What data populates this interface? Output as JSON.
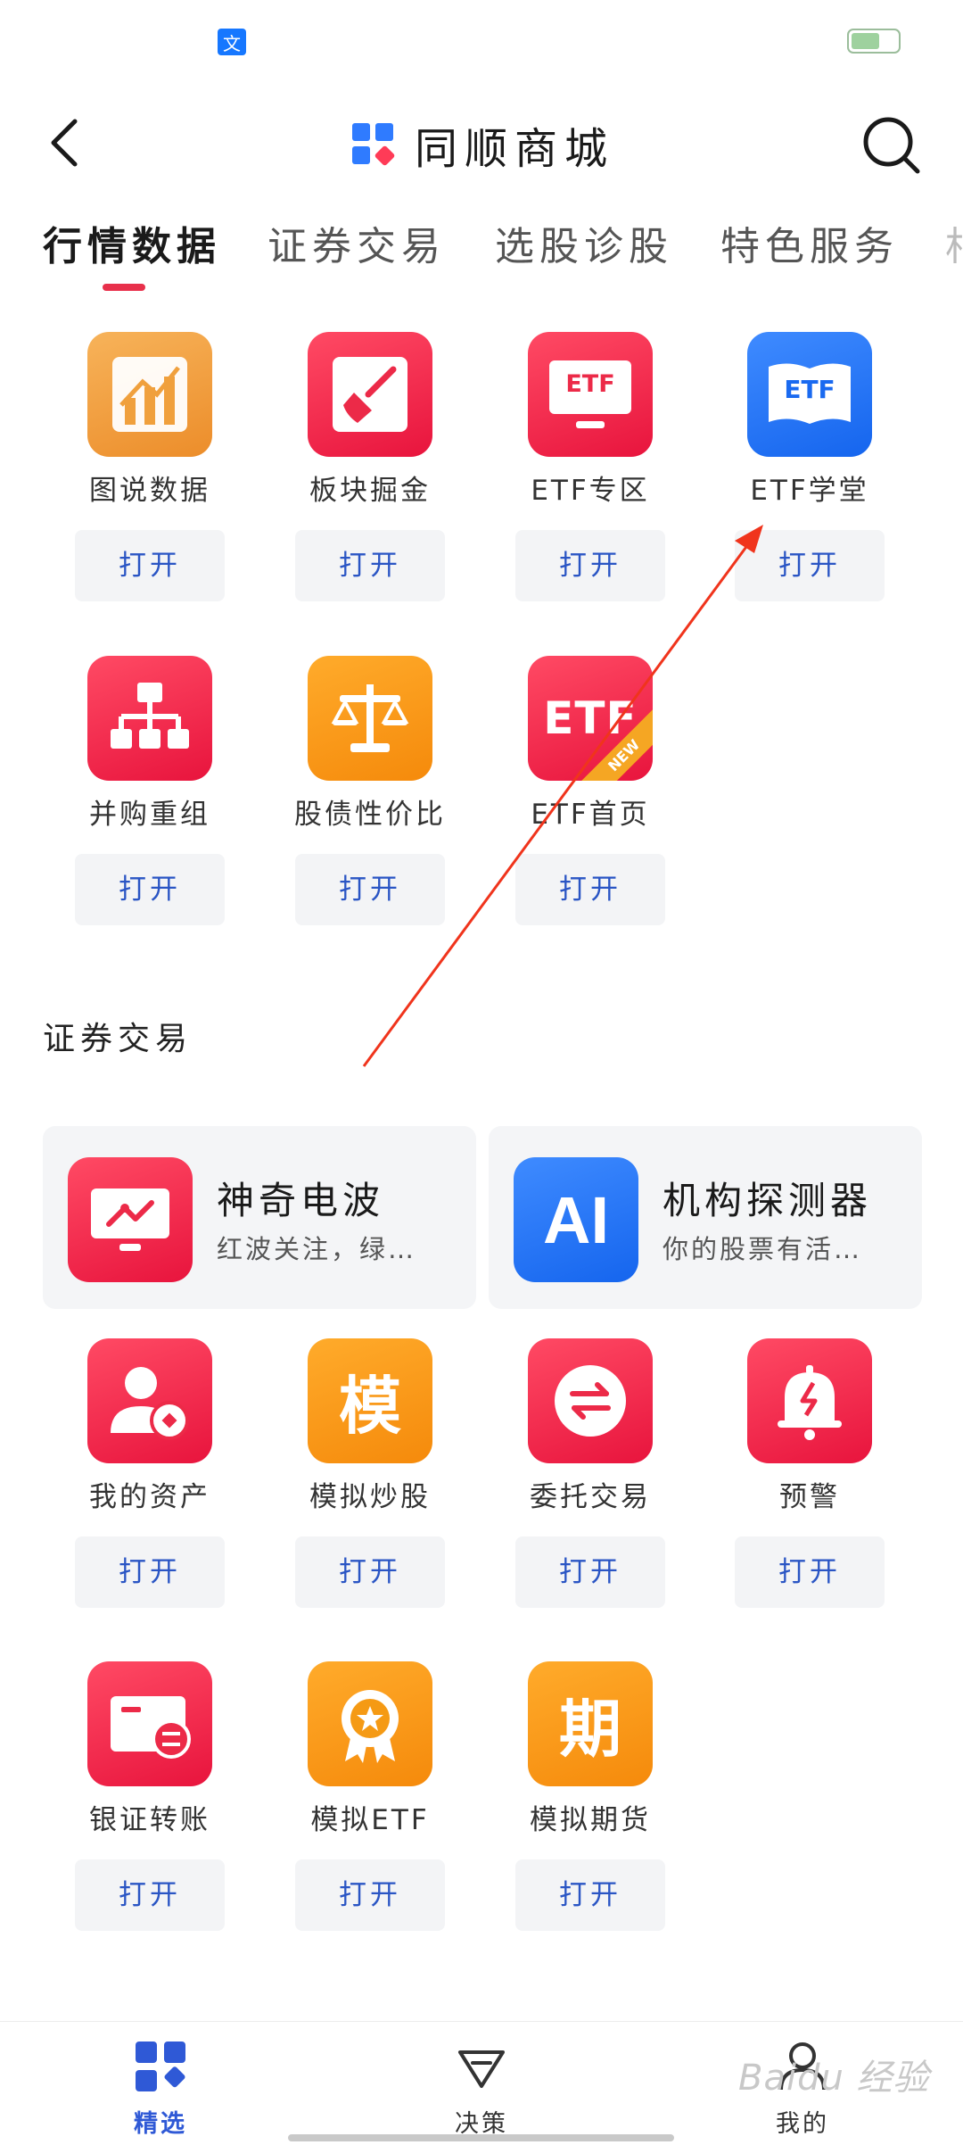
{
  "status_bar": {
    "app_badge": "文"
  },
  "header": {
    "title": "同顺商城"
  },
  "tabs": [
    "行情数据",
    "证券交易",
    "选股诊股",
    "特色服务",
    "相"
  ],
  "market_items": [
    {
      "label": "图说数据",
      "action": "打开"
    },
    {
      "label": "板块掘金",
      "action": "打开"
    },
    {
      "label": "ETF专区",
      "action": "打开",
      "icon_text": "ETF"
    },
    {
      "label": "ETF学堂",
      "action": "打开",
      "icon_text": "ETF"
    },
    {
      "label": "并购重组",
      "action": "打开"
    },
    {
      "label": "股债性价比",
      "action": "打开"
    },
    {
      "label": "ETF首页",
      "action": "打开",
      "icon_text": "ETF",
      "badge": "NEW"
    }
  ],
  "section_title": "证券交易",
  "feature_cards": [
    {
      "title": "神奇电波",
      "subtitle": "红波关注，绿…"
    },
    {
      "title": "机构探测器",
      "subtitle": "你的股票有活…",
      "icon_text": "AI"
    }
  ],
  "trade_items": [
    {
      "label": "我的资产",
      "action": "打开"
    },
    {
      "label": "模拟炒股",
      "action": "打开",
      "icon_text": "模"
    },
    {
      "label": "委托交易",
      "action": "打开"
    },
    {
      "label": "预警",
      "action": "打开"
    },
    {
      "label": "银证转账",
      "action": "打开"
    },
    {
      "label": "模拟ETF",
      "action": "打开"
    },
    {
      "label": "模拟期货",
      "action": "打开",
      "icon_text": "期"
    }
  ],
  "bottom_nav": [
    {
      "label": "精选"
    },
    {
      "label": "决策"
    },
    {
      "label": "我的"
    }
  ],
  "watermark": "Baidu 经验",
  "colors": {
    "accent_red": "#e8304b",
    "link_blue": "#2a55c4",
    "nav_blue": "#2f59d6"
  }
}
